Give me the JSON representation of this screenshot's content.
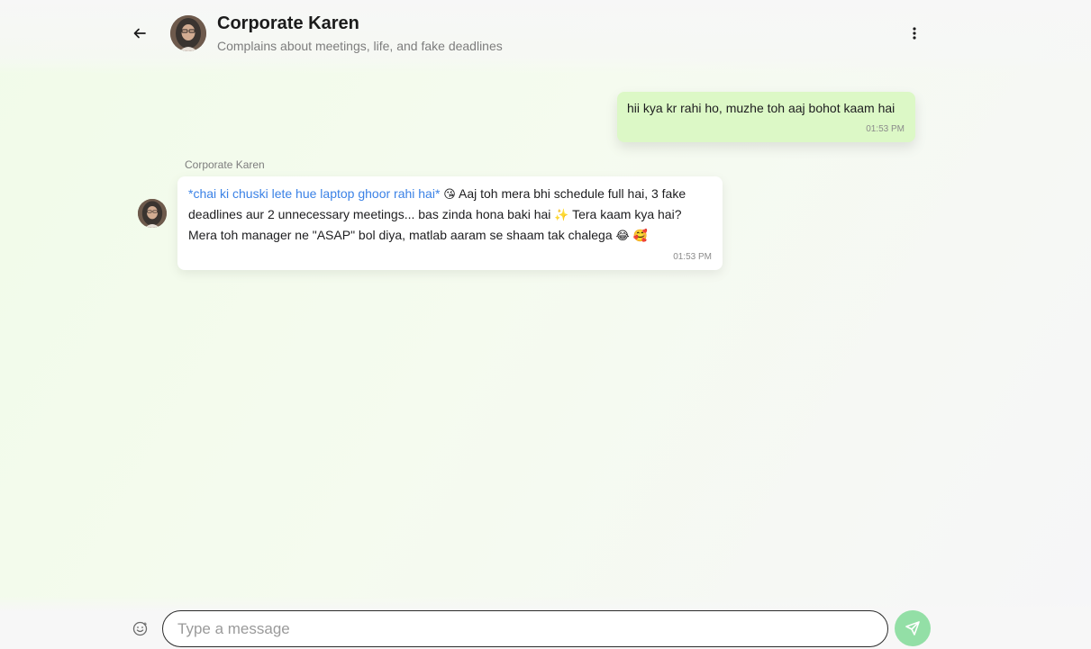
{
  "header": {
    "contact_name": "Corporate Karen",
    "contact_status": "Complains about meetings, life, and fake deadlines",
    "back_icon": "arrow-left-icon",
    "menu_icon": "more-vertical-icon"
  },
  "messages": [
    {
      "direction": "outgoing",
      "text": "hii kya kr rahi ho, muzhe toh aaj bohot kaam hai",
      "time": "01:53 PM"
    },
    {
      "direction": "incoming",
      "sender": "Corporate Karen",
      "action": "*chai ki chuski lete hue laptop ghoor rahi hai*",
      "emoji_1": "😘",
      "text_1": " Aaj toh mera bhi schedule full hai, 3 fake deadlines aur 2 unnecessary meetings... bas zinda hona baki hai ",
      "emoji_2": "✨",
      "text_2": " Tera kaam kya hai? Mera toh manager ne \"ASAP\" bol diya, matlab aaram se shaam tak chalega ",
      "emoji_3": "😂",
      "emoji_4": "🥰",
      "time": "01:53 PM"
    }
  ],
  "composer": {
    "placeholder": "Type a message",
    "value": "",
    "emoji_icon": "smiley-icon",
    "send_icon": "send-icon"
  },
  "colors": {
    "outgoing_bubble": "#dcf8c6",
    "incoming_bubble": "#ffffff",
    "action_text": "#3b82e6",
    "send_button": "#93dfa6"
  }
}
